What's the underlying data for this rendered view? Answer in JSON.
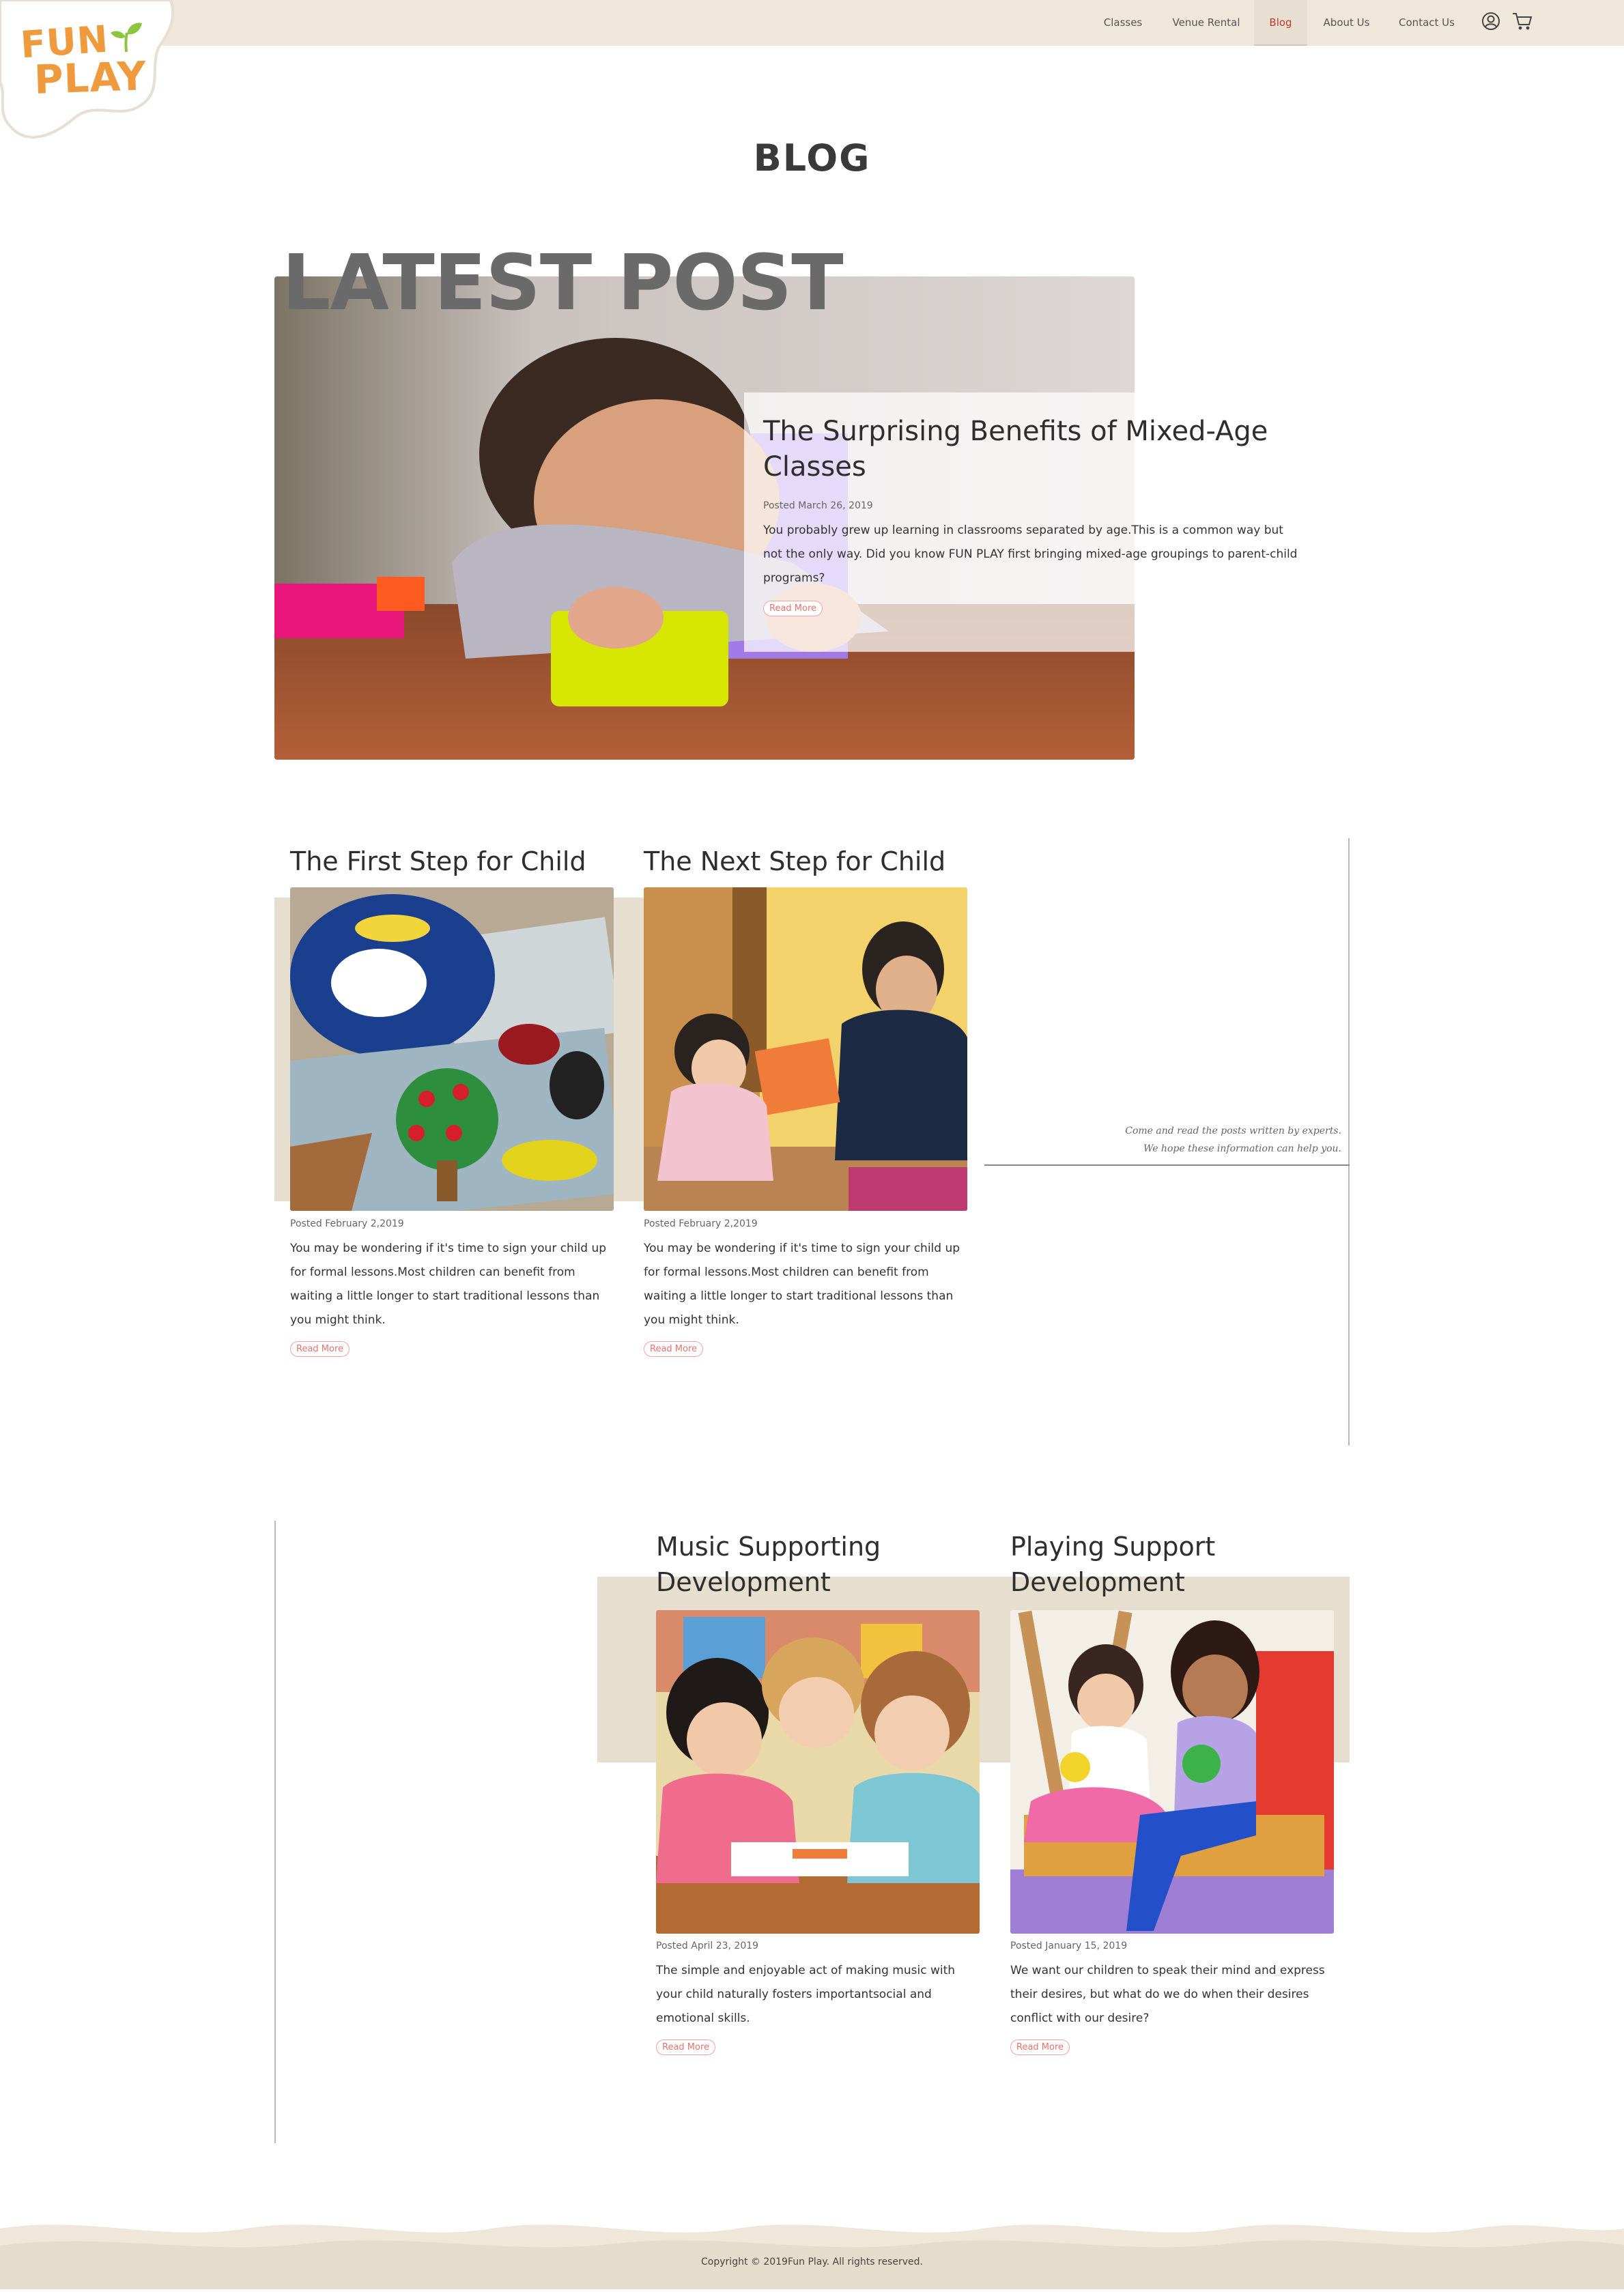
{
  "brand": {
    "logo_line1": "FUN",
    "logo_line2": "PLAY"
  },
  "nav": {
    "items": [
      {
        "label": "Classes"
      },
      {
        "label": "Venue Rental"
      },
      {
        "label": "Blog"
      },
      {
        "label": "About Us"
      },
      {
        "label": "Contact Us"
      }
    ],
    "active": "Blog"
  },
  "page": {
    "title": "BLOG",
    "section_heading": "LATEST POST"
  },
  "hero_post": {
    "title": "The Surprising Benefits of Mixed-Age Classes",
    "posted": "Posted March 26, 2019",
    "excerpt": "You probably grew up learning in classrooms separated by age.This is a common way but not the only way. Did you know FUN PLAY first bringing mixed-age groupings to parent-child programs?",
    "read_more": "Read More"
  },
  "row1": [
    {
      "title": "The First Step for Child",
      "posted": "Posted February 2,2019",
      "excerpt": "You may be wondering if it's time to sign your child up for formal lessons.Most children can benefit from waiting a little longer to start traditional lessons than you might think.",
      "read_more": "Read More"
    },
    {
      "title": "The Next Step for Child",
      "posted": "Posted February 2,2019",
      "excerpt": "You may be wondering if it's time to sign your child up for formal lessons.Most children can benefit from waiting a little longer to start traditional lessons than you might think.",
      "read_more": "Read More"
    }
  ],
  "quote": {
    "line1": "Come and read the posts written by experts.",
    "line2": "We hope these information can help you."
  },
  "row2": [
    {
      "title": "Music Supporting Development",
      "posted": "Posted April 23, 2019",
      "excerpt": "The simple and enjoyable act of making music with your child naturally fosters importantsocial and emotional skills.",
      "read_more": "Read More"
    },
    {
      "title": "Playing Support Development",
      "posted": "Posted January 15, 2019",
      "excerpt": "We want our children to speak their mind and express their desires, but what do we do when their desires conflict with our desire?",
      "read_more": "Read More"
    }
  ],
  "footer": {
    "copyright": "Copyright © 2019Fun Play. All rights reserved."
  },
  "colors": {
    "header_bg": "#efe8da",
    "accent_red": "#c0392b",
    "logo_orange": "#ef9a3c",
    "logo_green": "#8cc63f",
    "beige_panel": "#e6dfd0"
  }
}
